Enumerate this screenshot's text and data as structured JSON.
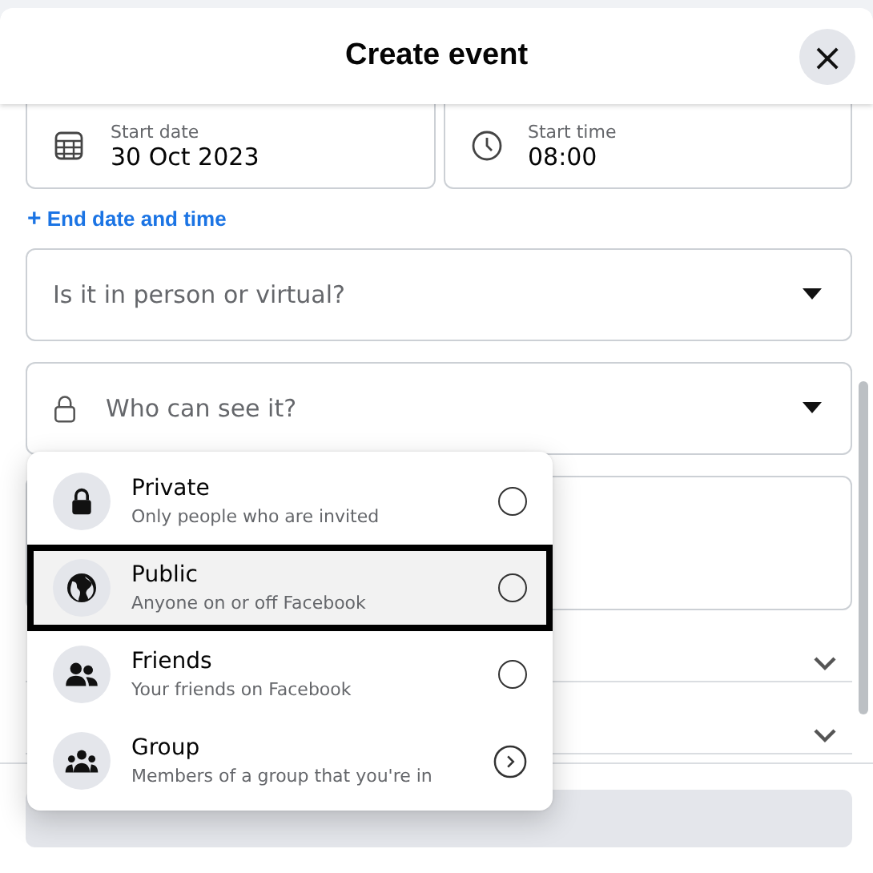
{
  "dialog": {
    "title": "Create event",
    "close_label": "×"
  },
  "start_date": {
    "label": "Start date",
    "value": "30 Oct 2023"
  },
  "start_time": {
    "label": "Start time",
    "value": "08:00"
  },
  "end_link": {
    "icon": "+",
    "label": "End date and time"
  },
  "location_field": {
    "placeholder": "Is it in person or virtual?"
  },
  "privacy_field": {
    "placeholder": "Who can see it?",
    "expanded": true
  },
  "privacy_options": [
    {
      "kind": "radio",
      "title": "Private",
      "subtitle": "Only people who are invited",
      "selected": false,
      "focused": false
    },
    {
      "kind": "radio",
      "title": "Public",
      "subtitle": "Anyone on or off Facebook",
      "selected": false,
      "focused": true
    },
    {
      "kind": "radio",
      "title": "Friends",
      "subtitle": "Your friends on Facebook",
      "selected": false,
      "focused": false
    },
    {
      "kind": "submenu",
      "title": "Group",
      "subtitle": "Members of a group that you're in",
      "selected": false,
      "focused": false
    }
  ],
  "create_button": {
    "disabled": true
  }
}
